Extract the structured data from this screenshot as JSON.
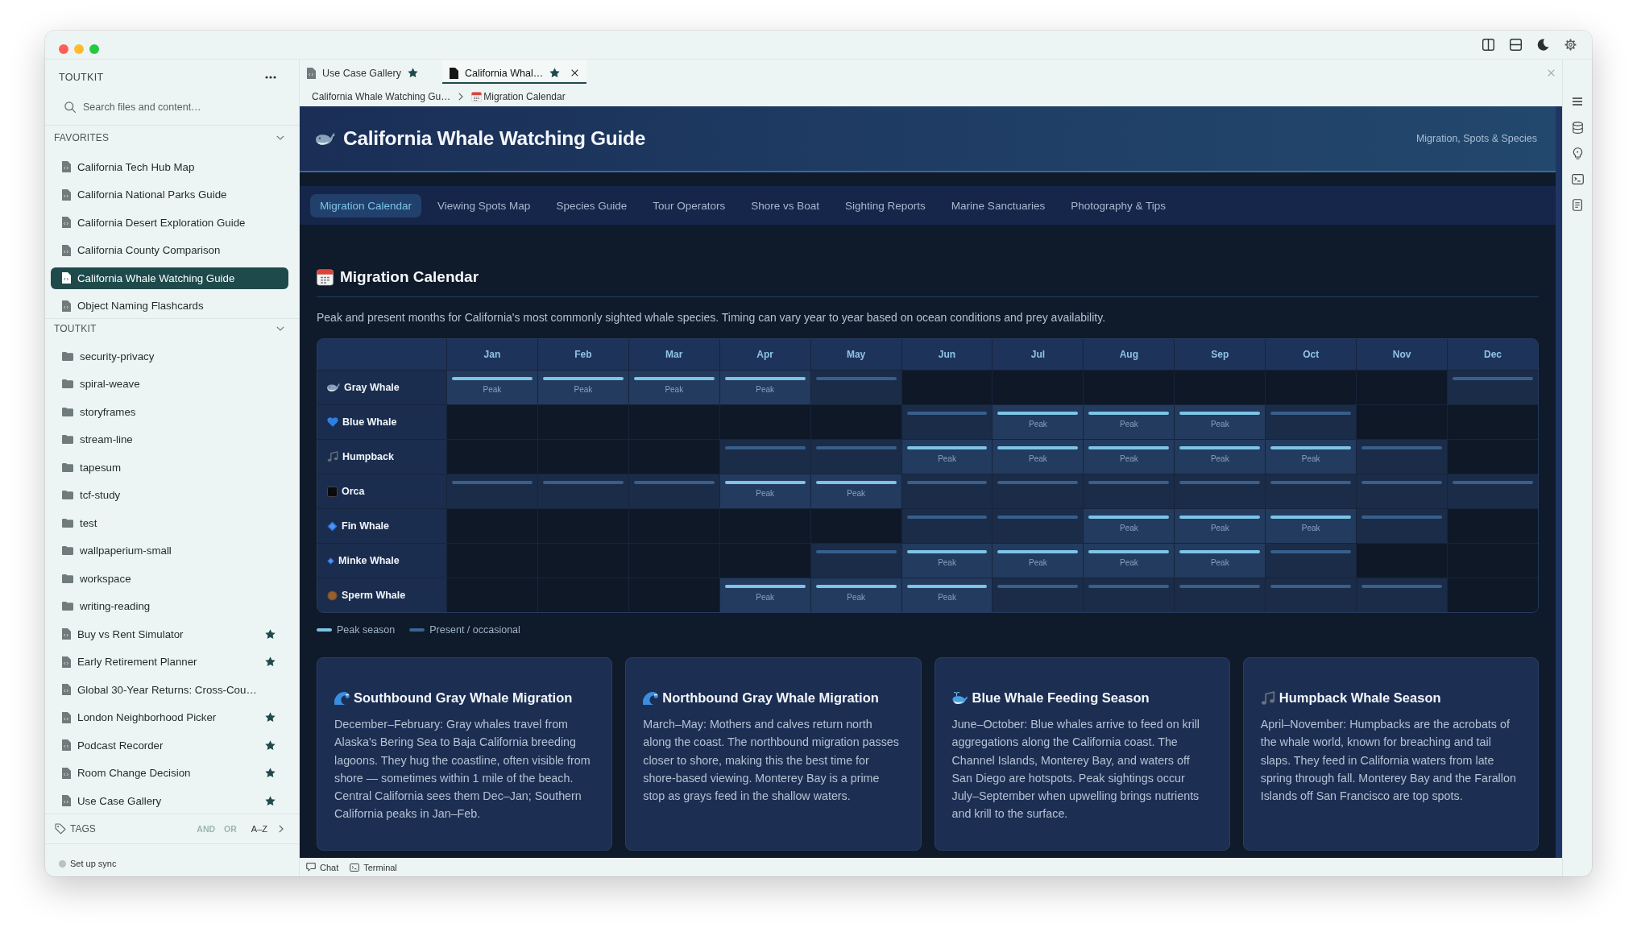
{
  "sidebar": {
    "workspace": "TOUTKIT",
    "search": {
      "placeholder": "Search files and content…"
    },
    "favorites": {
      "title": "FAVORITES",
      "expanded": true,
      "items": [
        {
          "label": "California Tech Hub Map",
          "selected": false
        },
        {
          "label": "California National Parks Guide",
          "selected": false
        },
        {
          "label": "California Desert Exploration Guide",
          "selected": false
        },
        {
          "label": "California County Comparison",
          "selected": false
        },
        {
          "label": "California Whale Watching Guide",
          "selected": true
        },
        {
          "label": "Object Naming Flashcards",
          "selected": false
        }
      ]
    },
    "workspace_section": {
      "title": "TOUTKIT",
      "expanded": true,
      "items": [
        {
          "label": "security-privacy",
          "kind": "folder",
          "selected": false,
          "starred": false
        },
        {
          "label": "spiral-weave",
          "kind": "folder",
          "selected": false,
          "starred": false
        },
        {
          "label": "storyframes",
          "kind": "folder",
          "selected": false,
          "starred": false
        },
        {
          "label": "stream-line",
          "kind": "folder",
          "selected": false,
          "starred": false
        },
        {
          "label": "tapesum",
          "kind": "folder",
          "selected": false,
          "starred": false
        },
        {
          "label": "tcf-study",
          "kind": "folder",
          "selected": false,
          "starred": false
        },
        {
          "label": "test",
          "kind": "folder",
          "selected": false,
          "starred": false
        },
        {
          "label": "wallpaperium-small",
          "kind": "folder",
          "selected": false,
          "starred": false
        },
        {
          "label": "workspace",
          "kind": "folder",
          "selected": false,
          "starred": false
        },
        {
          "label": "writing-reading",
          "kind": "folder",
          "selected": false,
          "starred": false
        },
        {
          "label": "Buy vs Rent Simulator",
          "kind": "file",
          "selected": false,
          "starred": true
        },
        {
          "label": "Early Retirement Planner",
          "kind": "file",
          "selected": false,
          "starred": true
        },
        {
          "label": "Global 30-Year Returns: Cross-Cou…",
          "kind": "file",
          "selected": false,
          "starred": false
        },
        {
          "label": "London Neighborhood Picker",
          "kind": "file",
          "selected": false,
          "starred": true
        },
        {
          "label": "Podcast Recorder",
          "kind": "file",
          "selected": false,
          "starred": true
        },
        {
          "label": "Room Change Decision",
          "kind": "file",
          "selected": false,
          "starred": true
        },
        {
          "label": "Use Case Gallery",
          "kind": "file",
          "selected": false,
          "starred": true
        }
      ]
    },
    "tags": {
      "title": "TAGS",
      "filters": [
        {
          "label": "AND",
          "on": false
        },
        {
          "label": "OR",
          "on": false
        }
      ],
      "sort": "A–Z"
    },
    "sync": "Set up sync"
  },
  "tabs": [
    {
      "label": "Use Case Gallery",
      "selected": false,
      "starred": true
    },
    {
      "label": "California Whal…",
      "selected": true,
      "starred": true
    }
  ],
  "breadcrumb": [
    "California Whale Watching Gu…",
    "Migration Calendar"
  ],
  "page": {
    "title": "California Whale Watching Guide",
    "subtitle": "Migration, Spots & Species",
    "nav": [
      {
        "label": "Migration Calendar",
        "selected": true
      },
      {
        "label": "Viewing Spots Map",
        "selected": false
      },
      {
        "label": "Species Guide",
        "selected": false
      },
      {
        "label": "Tour Operators",
        "selected": false
      },
      {
        "label": "Shore vs Boat",
        "selected": false
      },
      {
        "label": "Sighting Reports",
        "selected": false
      },
      {
        "label": "Marine Sanctuaries",
        "selected": false
      },
      {
        "label": "Photography & Tips",
        "selected": false
      }
    ],
    "section": {
      "title": "Migration Calendar",
      "description": "Peak and present months for California's most commonly sighted whale species. Timing can vary year to year based on ocean conditions and prey availability."
    },
    "calendar": {
      "months": [
        "Jan",
        "Feb",
        "Mar",
        "Apr",
        "May",
        "Jun",
        "Jul",
        "Aug",
        "Sep",
        "Oct",
        "Nov",
        "Dec"
      ],
      "rows": [
        {
          "name": "Gray Whale",
          "cells": [
            {
              "kind": "peak",
              "label": "Peak"
            },
            {
              "kind": "peak",
              "label": "Peak"
            },
            {
              "kind": "peak",
              "label": "Peak"
            },
            {
              "kind": "peak",
              "label": "Peak"
            },
            {
              "kind": "present"
            },
            {
              "kind": "empty"
            },
            {
              "kind": "empty"
            },
            {
              "kind": "empty"
            },
            {
              "kind": "empty"
            },
            {
              "kind": "empty"
            },
            {
              "kind": "empty"
            },
            {
              "kind": "present"
            }
          ]
        },
        {
          "name": "Blue Whale",
          "cells": [
            {
              "kind": "empty"
            },
            {
              "kind": "empty"
            },
            {
              "kind": "empty"
            },
            {
              "kind": "empty"
            },
            {
              "kind": "empty"
            },
            {
              "kind": "present"
            },
            {
              "kind": "peak",
              "label": "Peak"
            },
            {
              "kind": "peak",
              "label": "Peak"
            },
            {
              "kind": "peak",
              "label": "Peak"
            },
            {
              "kind": "present"
            },
            {
              "kind": "empty"
            },
            {
              "kind": "empty"
            }
          ]
        },
        {
          "name": "Humpback",
          "cells": [
            {
              "kind": "empty"
            },
            {
              "kind": "empty"
            },
            {
              "kind": "empty"
            },
            {
              "kind": "present"
            },
            {
              "kind": "present"
            },
            {
              "kind": "peak",
              "label": "Peak"
            },
            {
              "kind": "peak",
              "label": "Peak"
            },
            {
              "kind": "peak",
              "label": "Peak"
            },
            {
              "kind": "peak",
              "label": "Peak"
            },
            {
              "kind": "peak",
              "label": "Peak"
            },
            {
              "kind": "present"
            },
            {
              "kind": "empty"
            }
          ]
        },
        {
          "name": "Orca",
          "cells": [
            {
              "kind": "present"
            },
            {
              "kind": "present"
            },
            {
              "kind": "present"
            },
            {
              "kind": "peak",
              "label": "Peak"
            },
            {
              "kind": "peak",
              "label": "Peak"
            },
            {
              "kind": "present"
            },
            {
              "kind": "present"
            },
            {
              "kind": "present"
            },
            {
              "kind": "present"
            },
            {
              "kind": "present"
            },
            {
              "kind": "present"
            },
            {
              "kind": "present"
            }
          ]
        },
        {
          "name": "Fin Whale",
          "cells": [
            {
              "kind": "empty"
            },
            {
              "kind": "empty"
            },
            {
              "kind": "empty"
            },
            {
              "kind": "empty"
            },
            {
              "kind": "empty"
            },
            {
              "kind": "present"
            },
            {
              "kind": "present"
            },
            {
              "kind": "peak",
              "label": "Peak"
            },
            {
              "kind": "peak",
              "label": "Peak"
            },
            {
              "kind": "peak",
              "label": "Peak"
            },
            {
              "kind": "present"
            },
            {
              "kind": "empty"
            }
          ]
        },
        {
          "name": "Minke Whale",
          "cells": [
            {
              "kind": "empty"
            },
            {
              "kind": "empty"
            },
            {
              "kind": "empty"
            },
            {
              "kind": "empty"
            },
            {
              "kind": "present"
            },
            {
              "kind": "peak",
              "label": "Peak"
            },
            {
              "kind": "peak",
              "label": "Peak"
            },
            {
              "kind": "peak",
              "label": "Peak"
            },
            {
              "kind": "peak",
              "label": "Peak"
            },
            {
              "kind": "present"
            },
            {
              "kind": "empty"
            },
            {
              "kind": "empty"
            }
          ]
        },
        {
          "name": "Sperm Whale",
          "cells": [
            {
              "kind": "empty"
            },
            {
              "kind": "empty"
            },
            {
              "kind": "empty"
            },
            {
              "kind": "peak",
              "label": "Peak"
            },
            {
              "kind": "peak",
              "label": "Peak"
            },
            {
              "kind": "peak",
              "label": "Peak"
            },
            {
              "kind": "present"
            },
            {
              "kind": "present"
            },
            {
              "kind": "present"
            },
            {
              "kind": "present"
            },
            {
              "kind": "present"
            },
            {
              "kind": "empty"
            }
          ]
        }
      ]
    },
    "legend": [
      {
        "label": "Peak season",
        "color": "#7dc4e6"
      },
      {
        "label": "Present / occasional",
        "color": "#3b6592"
      }
    ],
    "cards": [
      {
        "title": "Southbound Gray Whale Migration",
        "text": "December–February: Gray whales travel from Alaska's Bering Sea to Baja California breeding lagoons. They hug the coastline, often visible from shore — sometimes within 1 mile of the beach. Central California sees them Dec–Jan; Southern California peaks in Jan–Feb."
      },
      {
        "title": "Northbound Gray Whale Migration",
        "text": "March–May: Mothers and calves return north along the coast. The northbound migration passes closer to shore, making this the best time for shore-based viewing. Monterey Bay is a prime stop as grays feed in the shallow waters."
      },
      {
        "title": "Blue Whale Feeding Season",
        "text": "June–October: Blue whales arrive to feed on krill aggregations along the California coast. The Channel Islands, Monterey Bay, and waters off San Diego are hotspots. Peak sightings occur July–September when upwelling brings nutrients and krill to the surface."
      },
      {
        "title": "Humpback Whale Season",
        "text": "April–November: Humpbacks are the acrobats of the whale world, known for breaching and tail slaps. They feed in California waters from late spring through fall. Monterey Bay and the Farallon Islands off San Francisco are top spots."
      }
    ]
  },
  "status_bar": [
    "Chat",
    "Terminal"
  ]
}
